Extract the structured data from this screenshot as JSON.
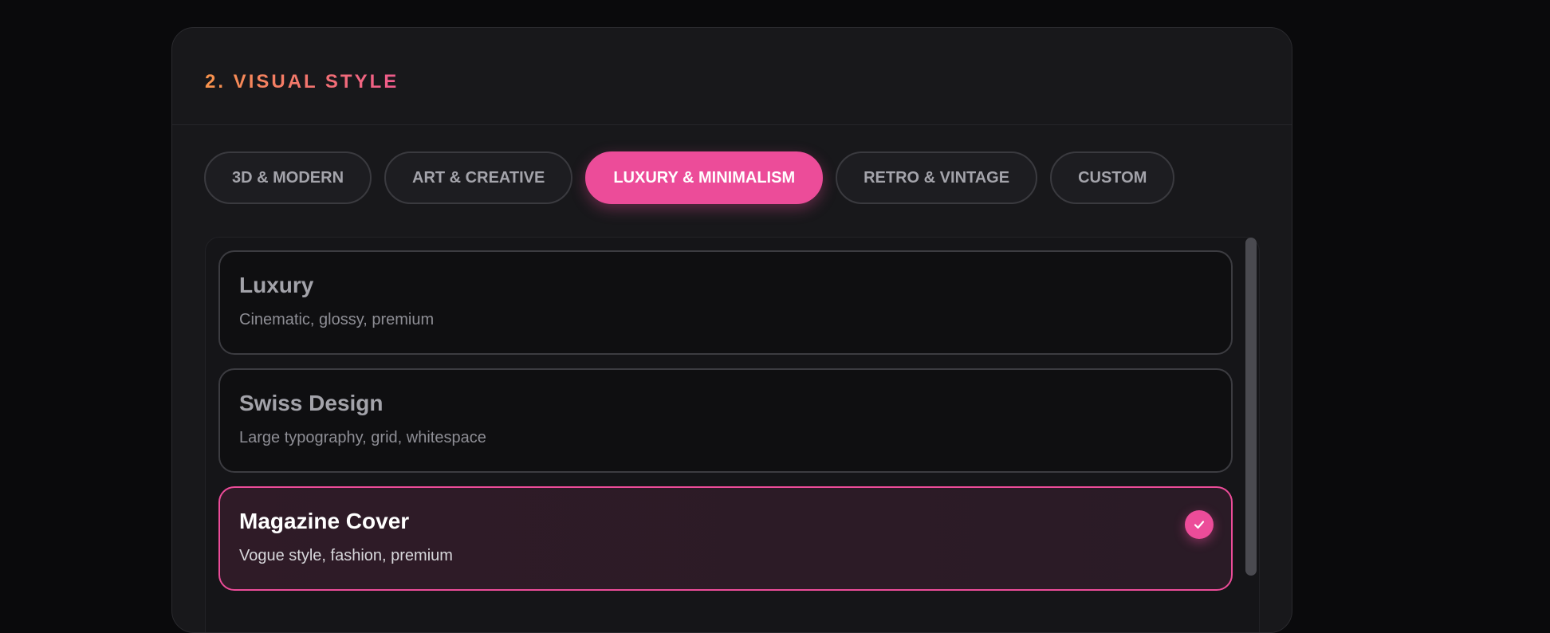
{
  "section": {
    "title": "2. VISUAL STYLE"
  },
  "tabs": [
    {
      "label": "3D & MODERN",
      "active": false
    },
    {
      "label": "ART & CREATIVE",
      "active": false
    },
    {
      "label": "LUXURY & MINIMALISM",
      "active": true
    },
    {
      "label": "RETRO & VINTAGE",
      "active": false
    },
    {
      "label": "CUSTOM",
      "active": false
    }
  ],
  "options": [
    {
      "title": "Luxury",
      "description": "Cinematic, glossy, premium",
      "selected": false
    },
    {
      "title": "Swiss Design",
      "description": "Large typography, grid, whitespace",
      "selected": false
    },
    {
      "title": "Magazine Cover",
      "description": "Vogue style, fashion, premium",
      "selected": true,
      "icon": "check-icon"
    }
  ],
  "colors": {
    "accent": "#ec4c99",
    "title_gradient_start": "#f7934c",
    "title_gradient_end": "#ef5a8d",
    "panel_bg": "#18181b",
    "page_bg": "#0a0a0c"
  }
}
